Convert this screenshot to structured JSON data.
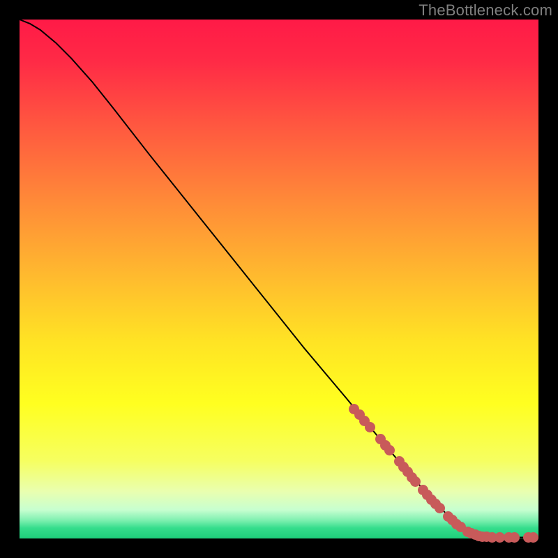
{
  "watermark": "TheBottleneck.com",
  "chart_data": {
    "type": "line",
    "title": "",
    "xlabel": "",
    "ylabel": "",
    "xlim": [
      0,
      100
    ],
    "ylim": [
      0,
      100
    ],
    "grid": false,
    "legend": false,
    "background_gradient_stops": [
      {
        "pos": 0.0,
        "color": "#ff1a47"
      },
      {
        "pos": 0.08,
        "color": "#ff2a46"
      },
      {
        "pos": 0.2,
        "color": "#ff5640"
      },
      {
        "pos": 0.35,
        "color": "#ff8a38"
      },
      {
        "pos": 0.5,
        "color": "#ffbc2e"
      },
      {
        "pos": 0.62,
        "color": "#ffe324"
      },
      {
        "pos": 0.74,
        "color": "#ffff20"
      },
      {
        "pos": 0.85,
        "color": "#f6ff60"
      },
      {
        "pos": 0.91,
        "color": "#e9ffb0"
      },
      {
        "pos": 0.945,
        "color": "#c7ffd0"
      },
      {
        "pos": 0.965,
        "color": "#7ef0b0"
      },
      {
        "pos": 0.98,
        "color": "#35dd8c"
      },
      {
        "pos": 1.0,
        "color": "#1ecf7b"
      }
    ],
    "series": [
      {
        "name": "bottleneck-curve",
        "color": "#000000",
        "stroke_width": 2,
        "points": [
          {
            "x": 0.0,
            "y": 100.0
          },
          {
            "x": 2.0,
            "y": 99.2
          },
          {
            "x": 4.0,
            "y": 98.0
          },
          {
            "x": 7.0,
            "y": 95.5
          },
          {
            "x": 10.0,
            "y": 92.5
          },
          {
            "x": 14.0,
            "y": 88.0
          },
          {
            "x": 18.0,
            "y": 83.0
          },
          {
            "x": 25.0,
            "y": 74.0
          },
          {
            "x": 35.0,
            "y": 61.5
          },
          {
            "x": 45.0,
            "y": 49.0
          },
          {
            "x": 55.0,
            "y": 36.5
          },
          {
            "x": 63.0,
            "y": 27.0
          },
          {
            "x": 70.0,
            "y": 18.5
          },
          {
            "x": 76.0,
            "y": 11.5
          },
          {
            "x": 80.0,
            "y": 7.0
          },
          {
            "x": 83.0,
            "y": 4.0
          },
          {
            "x": 85.5,
            "y": 2.0
          },
          {
            "x": 87.5,
            "y": 1.0
          },
          {
            "x": 89.0,
            "y": 0.5
          },
          {
            "x": 91.0,
            "y": 0.2
          },
          {
            "x": 100.0,
            "y": 0.2
          }
        ]
      }
    ],
    "markers": [
      {
        "name": "point",
        "color": "#c85a5a",
        "x": 64.5,
        "y": 25.0
      },
      {
        "name": "point",
        "color": "#c85a5a",
        "x": 65.5,
        "y": 23.8
      },
      {
        "name": "point",
        "color": "#c85a5a",
        "x": 66.5,
        "y": 22.6
      },
      {
        "name": "point",
        "color": "#c85a5a",
        "x": 67.5,
        "y": 21.4
      },
      {
        "name": "point",
        "color": "#c85a5a",
        "x": 69.5,
        "y": 19.2
      },
      {
        "name": "point",
        "color": "#c85a5a",
        "x": 70.5,
        "y": 18.0
      },
      {
        "name": "point",
        "color": "#c85a5a",
        "x": 71.3,
        "y": 17.0
      },
      {
        "name": "point",
        "color": "#c85a5a",
        "x": 73.2,
        "y": 14.8
      },
      {
        "name": "point",
        "color": "#c85a5a",
        "x": 74.0,
        "y": 13.8
      },
      {
        "name": "point",
        "color": "#c85a5a",
        "x": 74.8,
        "y": 12.8
      },
      {
        "name": "point",
        "color": "#c85a5a",
        "x": 75.6,
        "y": 11.8
      },
      {
        "name": "point",
        "color": "#c85a5a",
        "x": 76.3,
        "y": 11.0
      },
      {
        "name": "point",
        "color": "#c85a5a",
        "x": 77.8,
        "y": 9.3
      },
      {
        "name": "point",
        "color": "#c85a5a",
        "x": 78.6,
        "y": 8.4
      },
      {
        "name": "point",
        "color": "#c85a5a",
        "x": 79.4,
        "y": 7.5
      },
      {
        "name": "point",
        "color": "#c85a5a",
        "x": 80.2,
        "y": 6.6
      },
      {
        "name": "point",
        "color": "#c85a5a",
        "x": 81.0,
        "y": 5.8
      },
      {
        "name": "point",
        "color": "#c85a5a",
        "x": 82.6,
        "y": 4.3
      },
      {
        "name": "point",
        "color": "#c85a5a",
        "x": 83.4,
        "y": 3.5
      },
      {
        "name": "point",
        "color": "#c85a5a",
        "x": 84.2,
        "y": 2.8
      },
      {
        "name": "point",
        "color": "#c85a5a",
        "x": 85.0,
        "y": 2.2
      },
      {
        "name": "point",
        "color": "#c85a5a",
        "x": 86.4,
        "y": 1.3
      },
      {
        "name": "point",
        "color": "#c85a5a",
        "x": 87.0,
        "y": 1.0
      },
      {
        "name": "point",
        "color": "#c85a5a",
        "x": 87.8,
        "y": 0.7
      },
      {
        "name": "point",
        "color": "#c85a5a",
        "x": 88.5,
        "y": 0.5
      },
      {
        "name": "point",
        "color": "#c85a5a",
        "x": 89.2,
        "y": 0.4
      },
      {
        "name": "point",
        "color": "#c85a5a",
        "x": 90.0,
        "y": 0.3
      },
      {
        "name": "point",
        "color": "#c85a5a",
        "x": 91.0,
        "y": 0.2
      },
      {
        "name": "point",
        "color": "#c85a5a",
        "x": 92.6,
        "y": 0.2
      },
      {
        "name": "point",
        "color": "#c85a5a",
        "x": 94.3,
        "y": 0.2
      },
      {
        "name": "point",
        "color": "#c85a5a",
        "x": 95.3,
        "y": 0.2
      },
      {
        "name": "point",
        "color": "#c85a5a",
        "x": 98.0,
        "y": 0.2
      },
      {
        "name": "point",
        "color": "#c85a5a",
        "x": 99.0,
        "y": 0.2
      }
    ]
  }
}
